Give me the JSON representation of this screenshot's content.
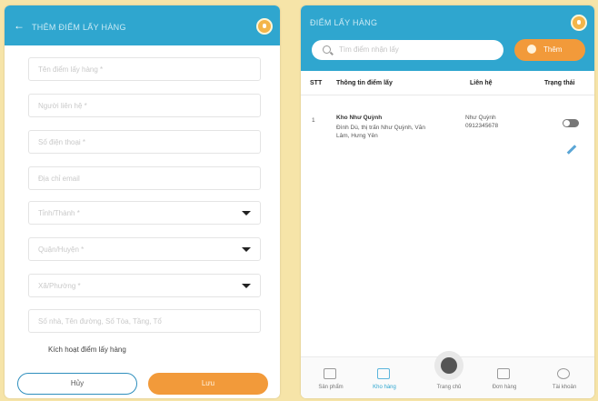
{
  "left_screen": {
    "title": "THÊM ĐIỂM LẤY HÀNG",
    "fields": [
      {
        "placeholder": "Tên điểm lấy hàng *",
        "dropdown": false
      },
      {
        "placeholder": "Người liên hệ *",
        "dropdown": false
      },
      {
        "placeholder": "Số điện thoại *",
        "dropdown": false
      },
      {
        "placeholder": "Địa chỉ email",
        "dropdown": false
      },
      {
        "placeholder": "Tỉnh/Thành *",
        "dropdown": true
      },
      {
        "placeholder": "Quận/Huyện *",
        "dropdown": true
      },
      {
        "placeholder": "Xã/Phường *",
        "dropdown": true
      },
      {
        "placeholder": "Số nhà, Tên đường, Số Tòa, Tầng, Tổ",
        "dropdown": false
      }
    ],
    "checkbox_label": "Kích hoạt điểm lấy hàng",
    "cancel_label": "Hủy",
    "save_label": "Lưu"
  },
  "right_screen": {
    "title": "ĐIỂM LẤY HÀNG",
    "search_placeholder": "Tìm điểm nhận lấy",
    "add_label": "Thêm",
    "columns": [
      "STT",
      "Thông tin điểm lấy",
      "Liên hệ",
      "Trạng thái"
    ],
    "rows": [
      {
        "stt": "1",
        "name": "Kho Như Quỳnh",
        "address": "Đình Dù, thị trấn Như Quỳnh, Văn Lâm, Hưng Yên",
        "contact_name": "Như Quỳnh",
        "contact_phone": "0912345678",
        "active": false
      }
    ],
    "nav": [
      "Sản phẩm",
      "Kho hàng",
      "Trang chủ",
      "Đơn hàng",
      "Tài khoản"
    ]
  },
  "colors": {
    "header": "#2fa6cf",
    "accent": "#f29a3a",
    "background": "#f6e4a8"
  }
}
